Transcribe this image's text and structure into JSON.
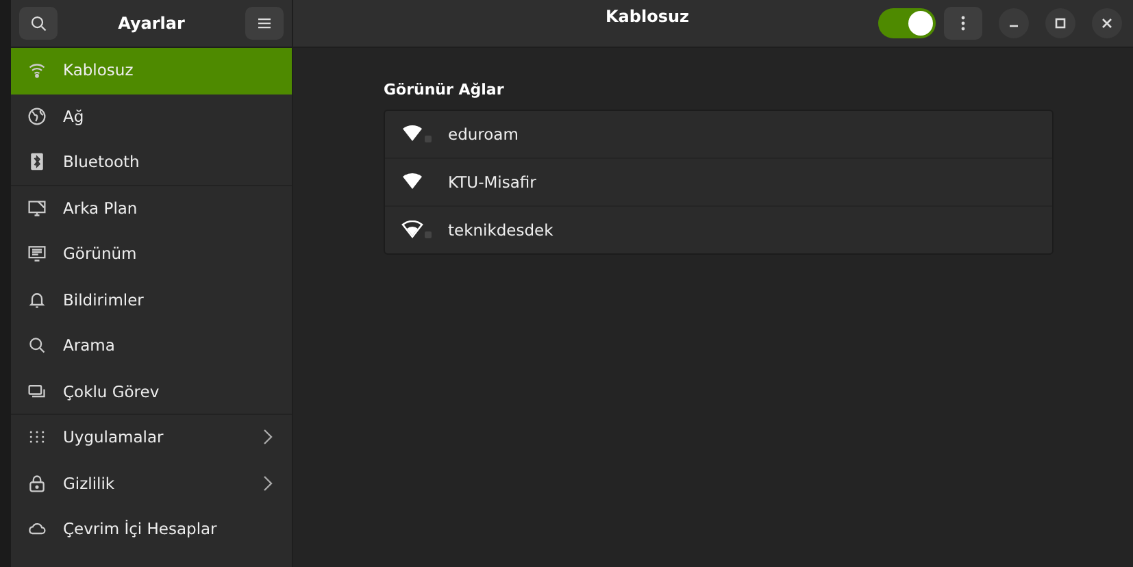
{
  "sidebar": {
    "title": "Ayarlar",
    "groups": [
      [
        {
          "label": "Kablosuz",
          "selected": true,
          "submenu": false
        },
        {
          "label": "Ağ",
          "selected": false,
          "submenu": false
        },
        {
          "label": "Bluetooth",
          "selected": false,
          "submenu": false
        }
      ],
      [
        {
          "label": "Arka Plan",
          "selected": false,
          "submenu": false
        },
        {
          "label": "Görünüm",
          "selected": false,
          "submenu": false
        },
        {
          "label": "Bildirimler",
          "selected": false,
          "submenu": false
        },
        {
          "label": "Arama",
          "selected": false,
          "submenu": false
        },
        {
          "label": "Çoklu Görev",
          "selected": false,
          "submenu": false
        }
      ],
      [
        {
          "label": "Uygulamalar",
          "selected": false,
          "submenu": true
        },
        {
          "label": "Gizlilik",
          "selected": false,
          "submenu": true
        },
        {
          "label": "Çevrim İçi Hesaplar",
          "selected": false,
          "submenu": false
        }
      ]
    ]
  },
  "header": {
    "title": "Kablosuz",
    "wifi_on": true
  },
  "networks": {
    "heading": "Görünür Ağlar",
    "items": [
      {
        "name": "eduroam",
        "strong": true,
        "secured": true
      },
      {
        "name": "KTU-Misafir",
        "strong": true,
        "secured": false
      },
      {
        "name": "teknikdesdek",
        "strong": false,
        "secured": true
      }
    ]
  }
}
